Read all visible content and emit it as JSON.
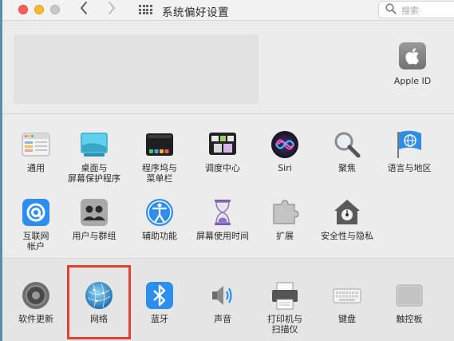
{
  "window": {
    "title": "系统偏好设置",
    "search_placeholder": "搜索"
  },
  "account": {
    "apple_id_label": "Apple ID"
  },
  "row1": [
    {
      "label": "通用",
      "icon": "general-icon"
    },
    {
      "label": "桌面与\n屏幕保护程序",
      "icon": "desktop-screensaver-icon"
    },
    {
      "label": "程序坞与\n菜单栏",
      "icon": "dock-menubar-icon"
    },
    {
      "label": "调度中心",
      "icon": "mission-control-icon"
    },
    {
      "label": "Siri",
      "icon": "siri-icon"
    },
    {
      "label": "聚焦",
      "icon": "spotlight-icon"
    },
    {
      "label": "语言与地区",
      "icon": "language-region-icon"
    }
  ],
  "row2": [
    {
      "label": "互联网\n帐户",
      "icon": "internet-accounts-icon"
    },
    {
      "label": "用户与群组",
      "icon": "users-groups-icon"
    },
    {
      "label": "辅助功能",
      "icon": "accessibility-icon"
    },
    {
      "label": "屏幕使用时间",
      "icon": "screen-time-icon"
    },
    {
      "label": "扩展",
      "icon": "extensions-icon"
    },
    {
      "label": "安全性与隐私",
      "icon": "security-privacy-icon"
    }
  ],
  "row3": [
    {
      "label": "软件更新",
      "icon": "software-update-icon"
    },
    {
      "label": "网络",
      "icon": "network-icon"
    },
    {
      "label": "蓝牙",
      "icon": "bluetooth-icon"
    },
    {
      "label": "声音",
      "icon": "sound-icon"
    },
    {
      "label": "打印机与\n扫描仪",
      "icon": "printers-scanners-icon"
    },
    {
      "label": "键盘",
      "icon": "keyboard-icon"
    },
    {
      "label": "触控板",
      "icon": "trackpad-icon"
    }
  ],
  "colors": {
    "highlight": "#e2412f",
    "close": "#fc5f57",
    "minimize": "#fdbc2e",
    "maximize": "#c8c8c8"
  }
}
